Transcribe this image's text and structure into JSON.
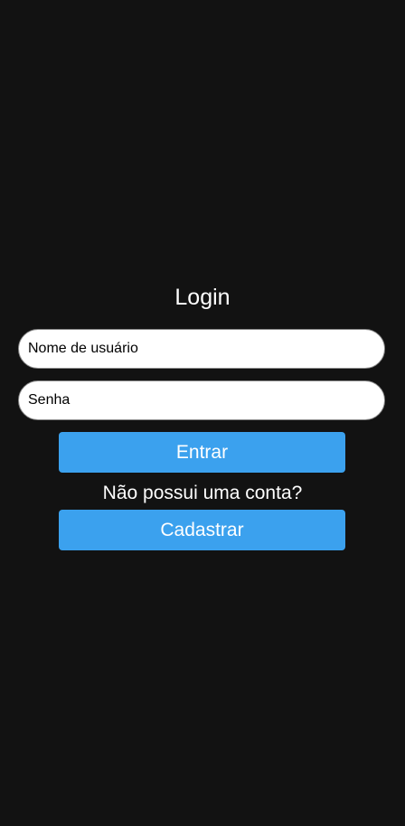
{
  "login": {
    "title": "Login",
    "username_placeholder": "Nome de usuário",
    "password_placeholder": "Senha",
    "login_button": "Entrar",
    "no_account_text": "Não possui uma conta?",
    "register_button": "Cadastrar"
  },
  "colors": {
    "background": "#121212",
    "button": "#3ba1ee",
    "field_background": "#ffffff"
  }
}
